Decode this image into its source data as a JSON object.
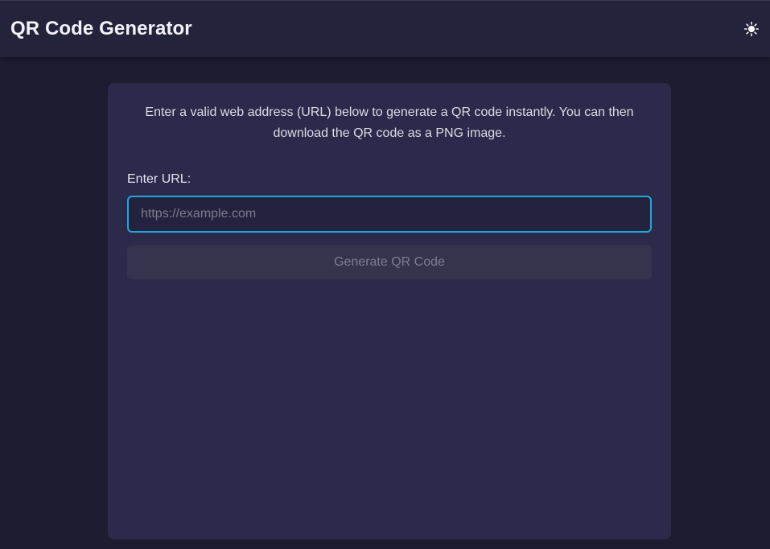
{
  "header": {
    "title": "QR Code Generator",
    "theme_toggle_icon": "sun-icon"
  },
  "main": {
    "description": "Enter a valid web address (URL) below to generate a QR code instantly. You can then download the QR code as a PNG image.",
    "url_label": "Enter URL:",
    "url_input": {
      "value": "",
      "placeholder": "https://example.com"
    },
    "generate_button_label": "Generate QR Code",
    "generate_button_disabled": true
  },
  "colors": {
    "page_background": "#1d1c30",
    "header_background": "#24233c",
    "card_background": "#2b2a4b",
    "input_focus_border": "#1fa7d8",
    "disabled_button": "#35344f"
  }
}
